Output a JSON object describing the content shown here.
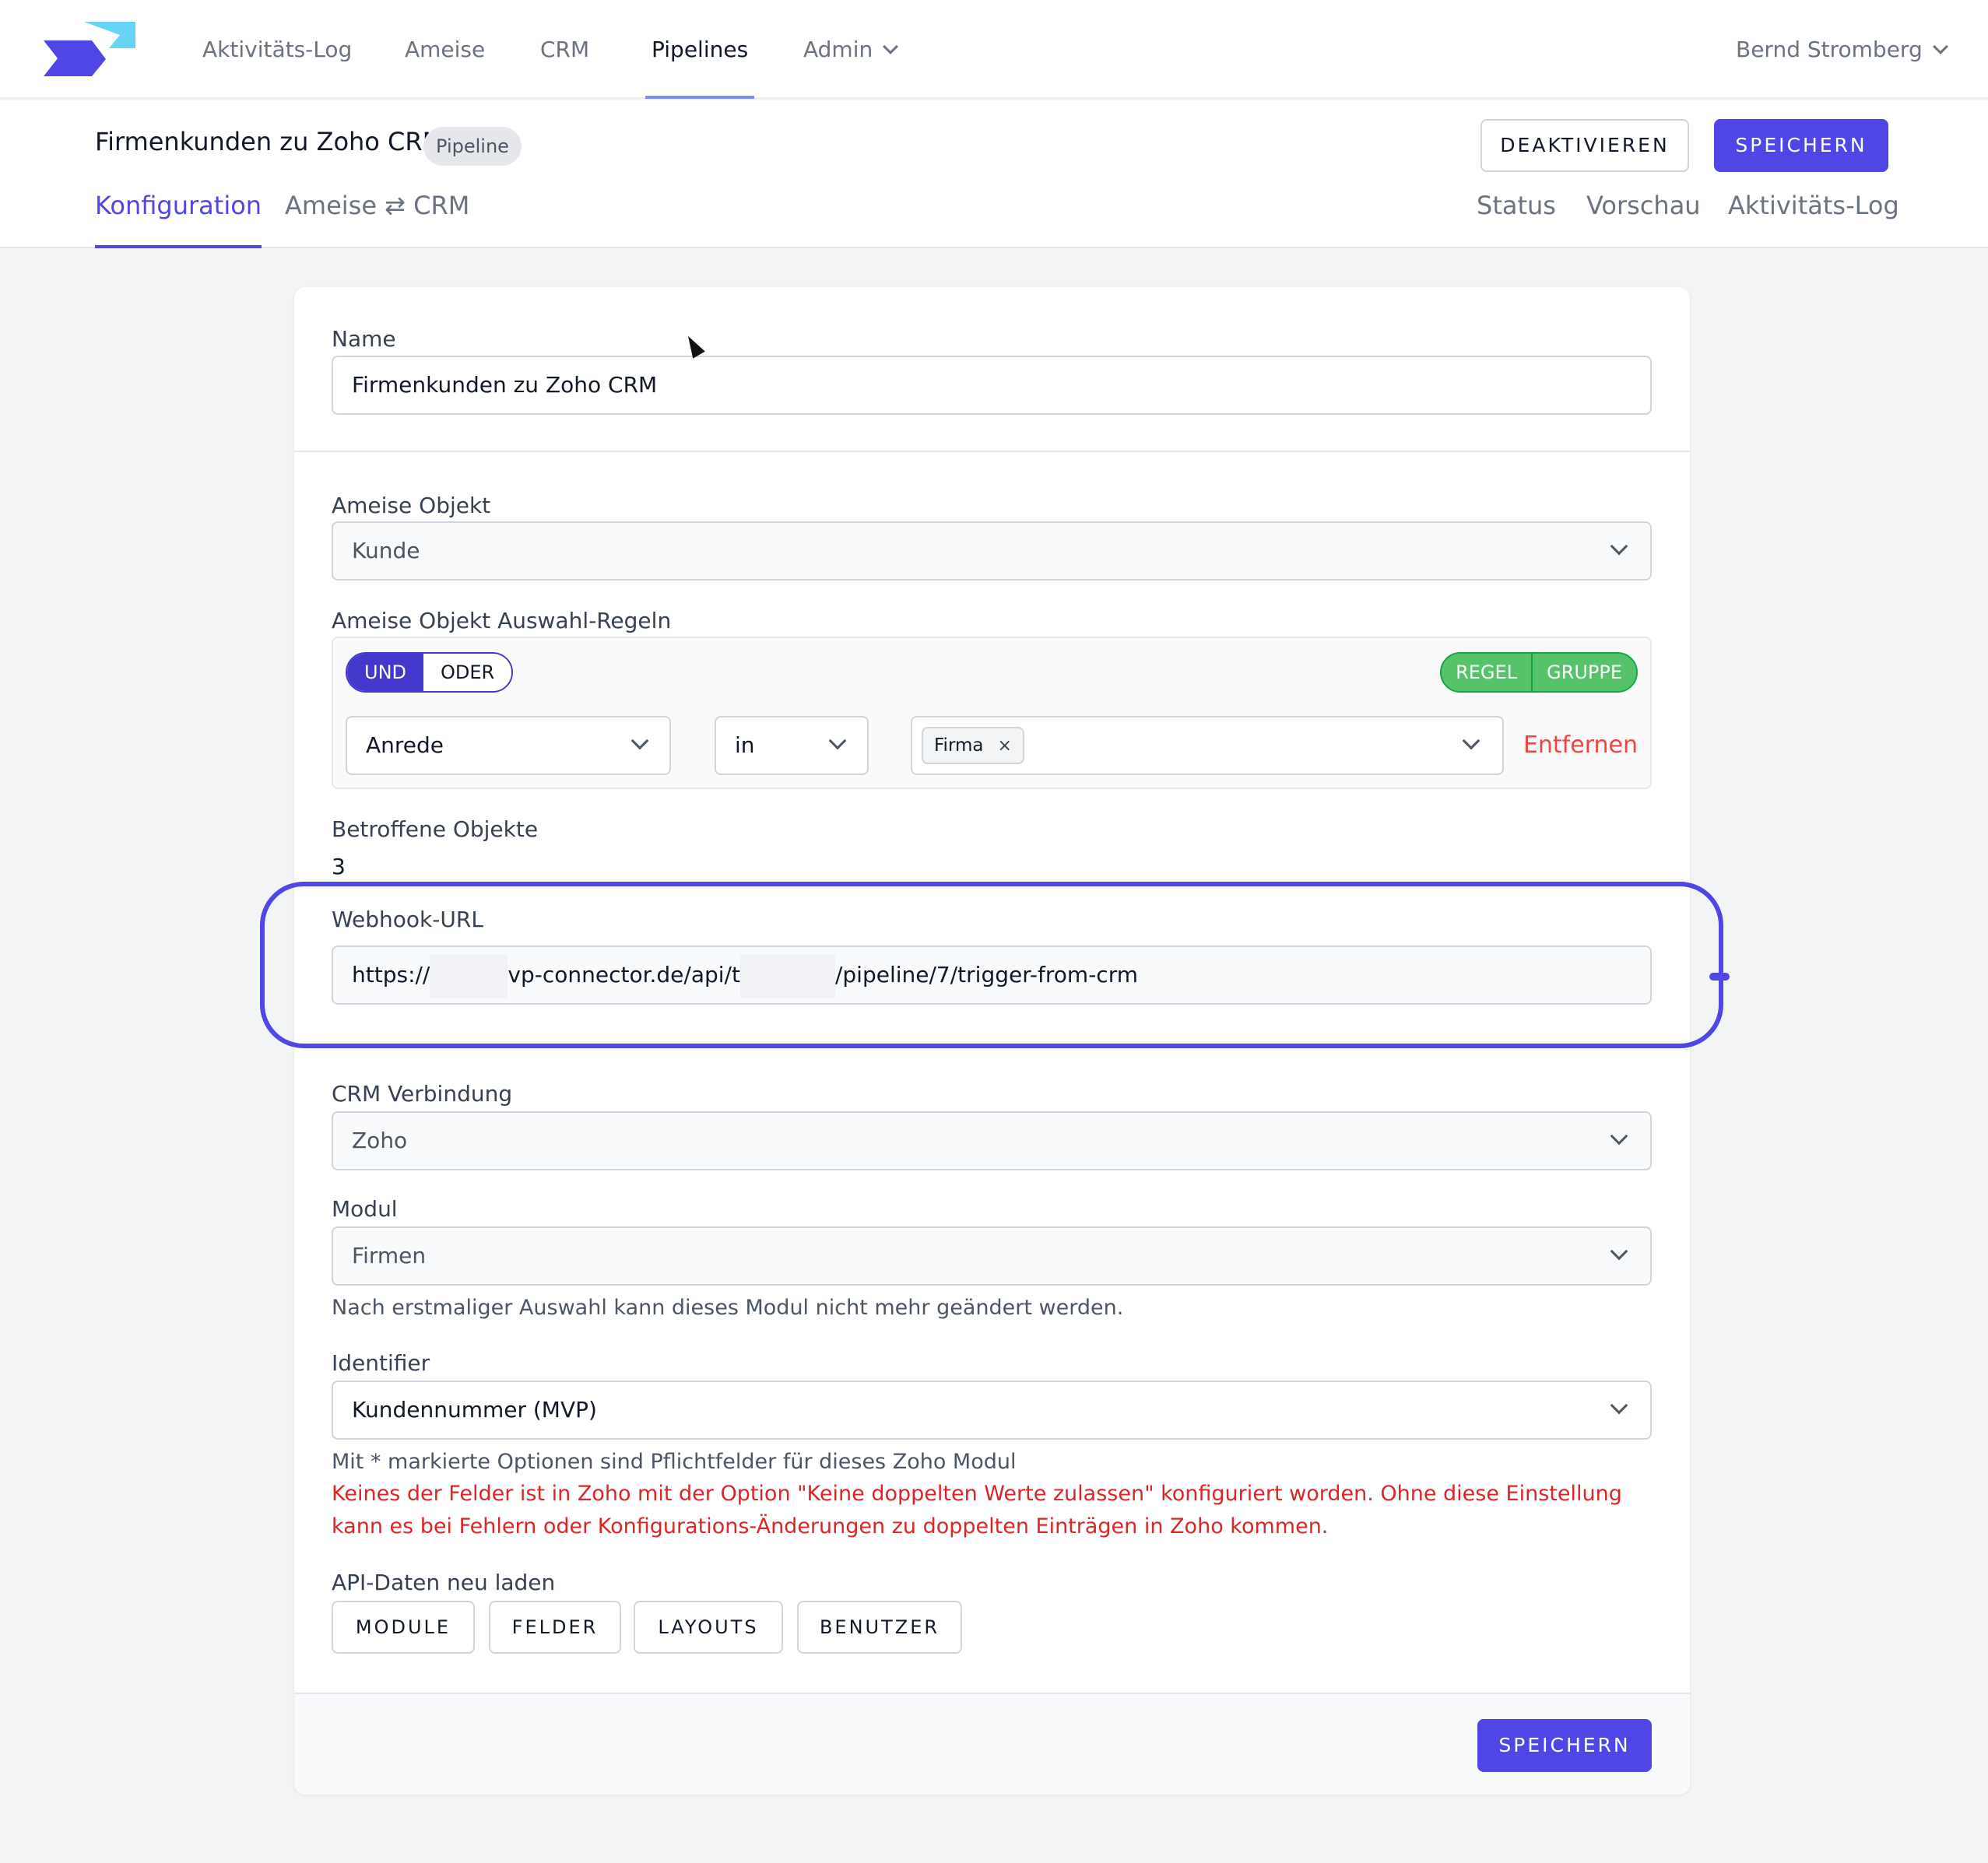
{
  "nav": {
    "items": [
      {
        "label": "Aktivitäts-Log"
      },
      {
        "label": "Ameise"
      },
      {
        "label": "CRM"
      },
      {
        "label": "Pipelines"
      },
      {
        "label": "Admin"
      }
    ],
    "active": "Pipelines",
    "user": "Bernd Stromberg",
    "logo_colors": {
      "primary": "#4f46e5",
      "secondary": "#67d4f5"
    }
  },
  "header": {
    "title": "Firmenkunden zu Zoho CRM",
    "badge": "Pipeline",
    "deactivate_label": "DEAKTIVIEREN",
    "save_label": "SPEICHERN",
    "tabs_left": [
      {
        "label": "Konfiguration"
      },
      {
        "label": "Ameise ⇄ CRM"
      }
    ],
    "tabs_right": [
      {
        "label": "Status"
      },
      {
        "label": "Vorschau"
      },
      {
        "label": "Aktivitäts-Log"
      }
    ],
    "active_tab": "Konfiguration"
  },
  "form": {
    "name_label": "Name",
    "name_value": "Firmenkunden zu Zoho CRM",
    "object_label": "Ameise Objekt",
    "object_value": "Kunde",
    "rules_label": "Ameise Objekt Auswahl-Regeln",
    "rules": {
      "and_label": "UND",
      "or_label": "ODER",
      "rule_label": "REGEL",
      "group_label": "GRUPPE",
      "field": "Anrede",
      "operator": "in",
      "value_chip": "Firma",
      "chip_remove": "×",
      "remove_label": "Entfernen"
    },
    "affected_label": "Betroffene Objekte",
    "affected_value": "3",
    "webhook_label": "Webhook-URL",
    "webhook_parts": [
      "https://",
      "vp-connector.de/api/t",
      "/pipeline/7/trigger-from-crm"
    ],
    "crm_label": "CRM Verbindung",
    "crm_value": "Zoho",
    "module_label": "Modul",
    "module_value": "Firmen",
    "module_help": "Nach erstmaliger Auswahl kann dieses Modul nicht mehr geändert werden.",
    "identifier_label": "Identifier",
    "identifier_value": "Kundennummer (MVP)",
    "identifier_help": "Mit * markierte Optionen sind Pflichtfelder für dieses Zoho Modul",
    "identifier_error": "Keines der Felder ist in Zoho mit der Option \"Keine doppelten Werte zulassen\" konfiguriert worden. Ohne diese Einstellung kann es bei Fehlern oder Konfigurations-Änderungen zu doppelten Einträgen in Zoho kommen.",
    "reload_label": "API-Daten neu laden",
    "reload_buttons": [
      {
        "label": "MODULE"
      },
      {
        "label": "FELDER"
      },
      {
        "label": "LAYOUTS"
      },
      {
        "label": "BENUTZER"
      }
    ],
    "footer_save_label": "SPEICHERN"
  },
  "colors": {
    "accent": "#4f46e5",
    "success": "#56c26a",
    "danger": "#dc2626"
  }
}
